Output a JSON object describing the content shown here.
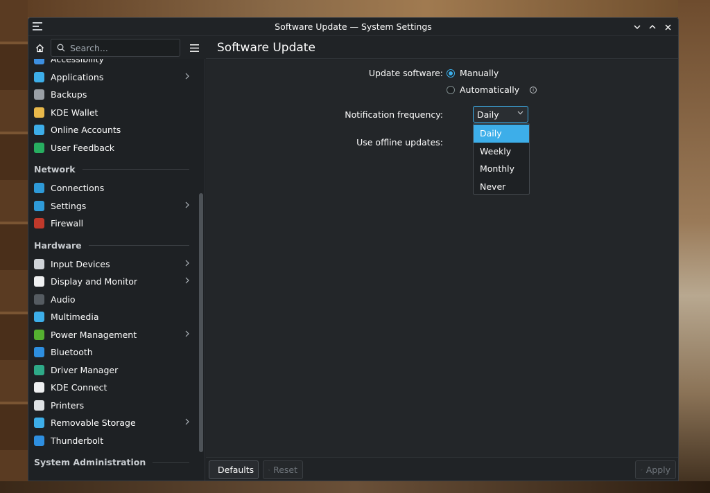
{
  "window": {
    "title": "Software Update — System Settings"
  },
  "search": {
    "placeholder": "Search..."
  },
  "sidebar": {
    "groups": [
      {
        "type": "item",
        "label": "Accessibility",
        "icon": "accessibility-icon",
        "color": "#3d8fe0",
        "chevron": false
      },
      {
        "type": "item",
        "label": "Applications",
        "icon": "applications-icon",
        "color": "#3daee9",
        "chevron": true
      },
      {
        "type": "item",
        "label": "Backups",
        "icon": "backups-icon",
        "color": "#9aa0a6",
        "chevron": false
      },
      {
        "type": "item",
        "label": "KDE Wallet",
        "icon": "wallet-icon",
        "color": "#e8b84a",
        "chevron": false
      },
      {
        "type": "item",
        "label": "Online Accounts",
        "icon": "online-accounts-icon",
        "color": "#3daee9",
        "chevron": false
      },
      {
        "type": "item",
        "label": "User Feedback",
        "icon": "feedback-icon",
        "color": "#27ae60",
        "chevron": false
      },
      {
        "type": "section",
        "label": "Network"
      },
      {
        "type": "item",
        "label": "Connections",
        "icon": "connections-icon",
        "color": "#2e9ad8",
        "chevron": false
      },
      {
        "type": "item",
        "label": "Settings",
        "icon": "network-settings-icon",
        "color": "#2e9ad8",
        "chevron": true
      },
      {
        "type": "item",
        "label": "Firewall",
        "icon": "firewall-icon",
        "color": "#c0392b",
        "chevron": false
      },
      {
        "type": "section",
        "label": "Hardware"
      },
      {
        "type": "item",
        "label": "Input Devices",
        "icon": "mouse-icon",
        "color": "#d0d4d8",
        "chevron": true
      },
      {
        "type": "item",
        "label": "Display and Monitor",
        "icon": "monitor-icon",
        "color": "#eff0f1",
        "chevron": true
      },
      {
        "type": "item",
        "label": "Audio",
        "icon": "audio-icon",
        "color": "#555b61",
        "chevron": false
      },
      {
        "type": "item",
        "label": "Multimedia",
        "icon": "multimedia-icon",
        "color": "#3daee9",
        "chevron": false
      },
      {
        "type": "item",
        "label": "Power Management",
        "icon": "power-icon",
        "color": "#55b030",
        "chevron": true
      },
      {
        "type": "item",
        "label": "Bluetooth",
        "icon": "bluetooth-icon",
        "color": "#2e8fe0",
        "chevron": false
      },
      {
        "type": "item",
        "label": "Driver Manager",
        "icon": "driver-icon",
        "color": "#2eaa88",
        "chevron": false
      },
      {
        "type": "item",
        "label": "KDE Connect",
        "icon": "kde-connect-icon",
        "color": "#eff0f1",
        "chevron": false
      },
      {
        "type": "item",
        "label": "Printers",
        "icon": "printer-icon",
        "color": "#dfe2e5",
        "chevron": false
      },
      {
        "type": "item",
        "label": "Removable Storage",
        "icon": "usb-icon",
        "color": "#3daee9",
        "chevron": true
      },
      {
        "type": "item",
        "label": "Thunderbolt",
        "icon": "thunderbolt-icon",
        "color": "#2e8fe0",
        "chevron": false
      },
      {
        "type": "section",
        "label": "System Administration"
      }
    ]
  },
  "page": {
    "heading": "Software Update",
    "update_software_label": "Update software:",
    "option_manually": "Manually",
    "option_automatically": "Automatically",
    "notification_label": "Notification frequency:",
    "notification_value": "Daily",
    "offline_label": "Use offline updates:",
    "dropdown_options": [
      "Daily",
      "Weekly",
      "Monthly",
      "Never"
    ],
    "selected_option": "Daily"
  },
  "footer": {
    "defaults_label": "Defaults",
    "reset_label": "Reset",
    "apply_label": "Apply"
  },
  "colors": {
    "accent": "#3daee9",
    "background": "#232629",
    "sidebar_background": "#1e2124"
  }
}
